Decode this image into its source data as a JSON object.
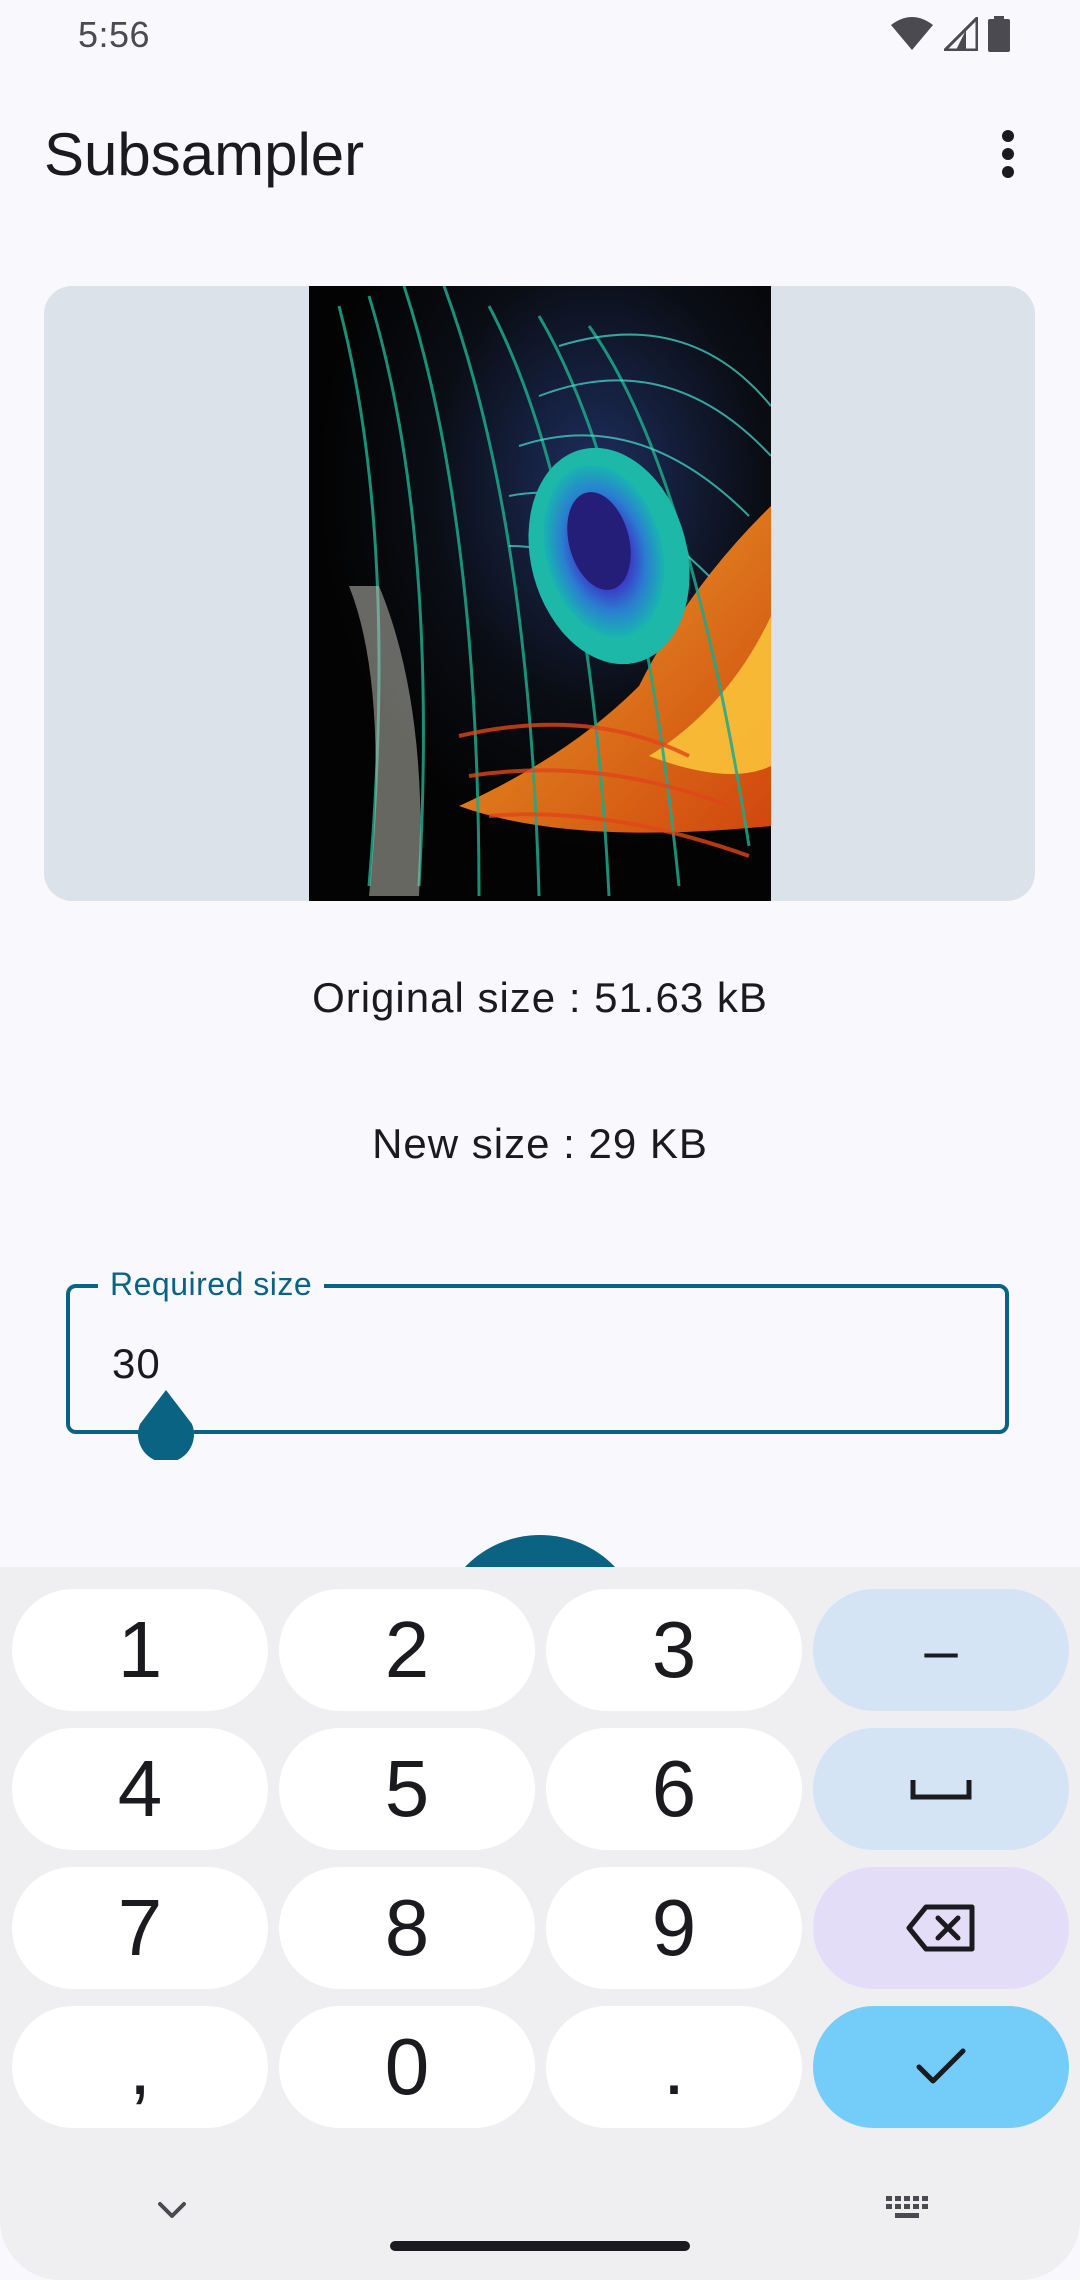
{
  "status_bar": {
    "time": "5:56",
    "icons": [
      "wifi-icon",
      "cellular-signal-icon",
      "battery-icon"
    ]
  },
  "app_bar": {
    "title": "Subsampler",
    "overflow_icon": "more-vert-icon"
  },
  "image_preview": {
    "subject": "peacock feather photo"
  },
  "sizes": {
    "original": "Original size : 51.63 kB",
    "new": "New size : 29 KB"
  },
  "required_size_field": {
    "label": "Required size",
    "value": "30"
  },
  "keyboard": {
    "rows": [
      [
        {
          "label": "1",
          "kind": "digit"
        },
        {
          "label": "2",
          "kind": "digit"
        },
        {
          "label": "3",
          "kind": "digit"
        },
        {
          "label": "–",
          "kind": "fn"
        }
      ],
      [
        {
          "label": "4",
          "kind": "digit"
        },
        {
          "label": "5",
          "kind": "digit"
        },
        {
          "label": "6",
          "kind": "digit"
        },
        {
          "label": "",
          "kind": "fn",
          "icon": "space-icon"
        }
      ],
      [
        {
          "label": "7",
          "kind": "digit"
        },
        {
          "label": "8",
          "kind": "digit"
        },
        {
          "label": "9",
          "kind": "digit"
        },
        {
          "label": "",
          "kind": "del",
          "icon": "backspace-icon"
        }
      ],
      [
        {
          "label": ",",
          "kind": "digit"
        },
        {
          "label": "0",
          "kind": "digit"
        },
        {
          "label": ".",
          "kind": "digit"
        },
        {
          "label": "",
          "kind": "done",
          "icon": "check-icon"
        }
      ]
    ],
    "bottom_icons": [
      "chevron-down-icon",
      "keyboard-icon"
    ]
  },
  "colors": {
    "primary": "#0B6384",
    "background": "#F9F9FD",
    "card": "#DCE2E9",
    "keyboard_bg": "#EFEFF2",
    "key_fn": "#D4E4F4",
    "key_delete": "#E3DDF7",
    "key_done": "#74CCF8"
  }
}
